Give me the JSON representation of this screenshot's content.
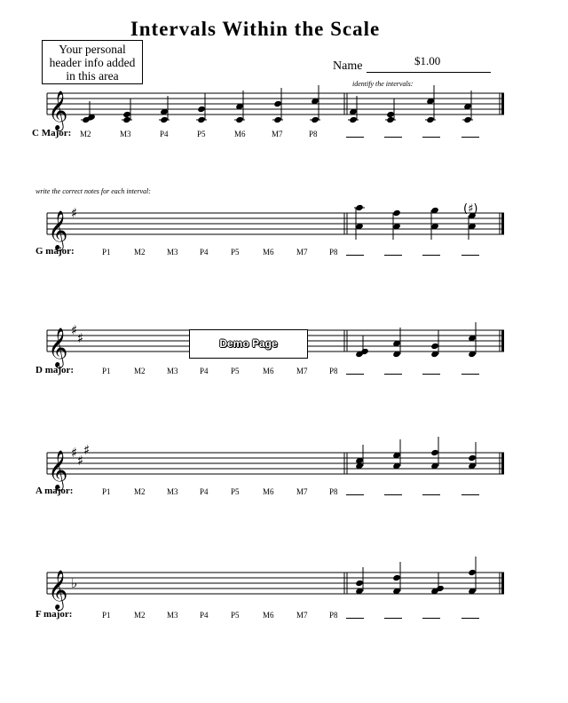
{
  "title": "Intervals Within the Scale",
  "header_box": {
    "lines": [
      "Your personal",
      "header info added",
      "in this area"
    ]
  },
  "name_label": "Name",
  "price": "$1.00",
  "instructions": {
    "identify": "identify the intervals:",
    "write": "write the correct notes for each interval:"
  },
  "watermark": "Demo Page",
  "staves": [
    {
      "key": "C Major:",
      "accidental": "none",
      "intervals": [
        "M2",
        "M3",
        "P4",
        "P5",
        "M6",
        "M7",
        "P8"
      ]
    },
    {
      "key": "G major:",
      "accidental": "sharp",
      "count": 1,
      "intervals": [
        "P1",
        "M2",
        "M3",
        "P4",
        "P5",
        "M6",
        "M7",
        "P8"
      ]
    },
    {
      "key": "D major:",
      "accidental": "sharp",
      "count": 2,
      "intervals": [
        "P1",
        "M2",
        "M3",
        "P4",
        "P5",
        "M6",
        "M7",
        "P8"
      ]
    },
    {
      "key": "A major:",
      "accidental": "sharp",
      "count": 3,
      "intervals": [
        "P1",
        "M2",
        "M3",
        "P4",
        "P5",
        "M6",
        "M7",
        "P8"
      ]
    },
    {
      "key": "F major:",
      "accidental": "flat",
      "count": 1,
      "intervals": [
        "P1",
        "M2",
        "M3",
        "P4",
        "P5",
        "M6",
        "M7",
        "P8"
      ]
    }
  ]
}
